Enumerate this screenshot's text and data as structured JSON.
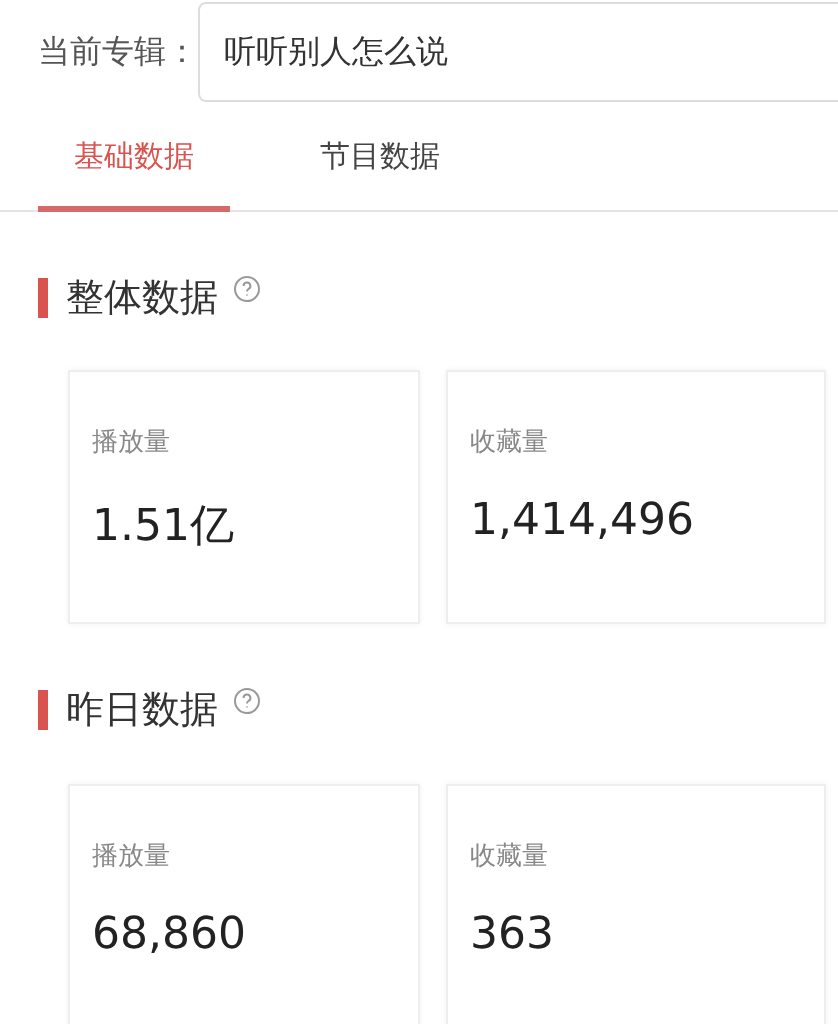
{
  "album": {
    "label": "当前专辑：",
    "value": "听听别人怎么说"
  },
  "tabs": [
    {
      "label": "基础数据",
      "selected": true
    },
    {
      "label": "节目数据",
      "selected": false
    }
  ],
  "sections": [
    {
      "title": "整体数据",
      "cards": [
        {
          "label": "播放量",
          "value": "1.51亿"
        },
        {
          "label": "收藏量",
          "value": "1,414,496"
        }
      ]
    },
    {
      "title": "昨日数据",
      "cards": [
        {
          "label": "播放量",
          "value": "68,860"
        },
        {
          "label": "收藏量",
          "value": "363"
        }
      ]
    }
  ]
}
